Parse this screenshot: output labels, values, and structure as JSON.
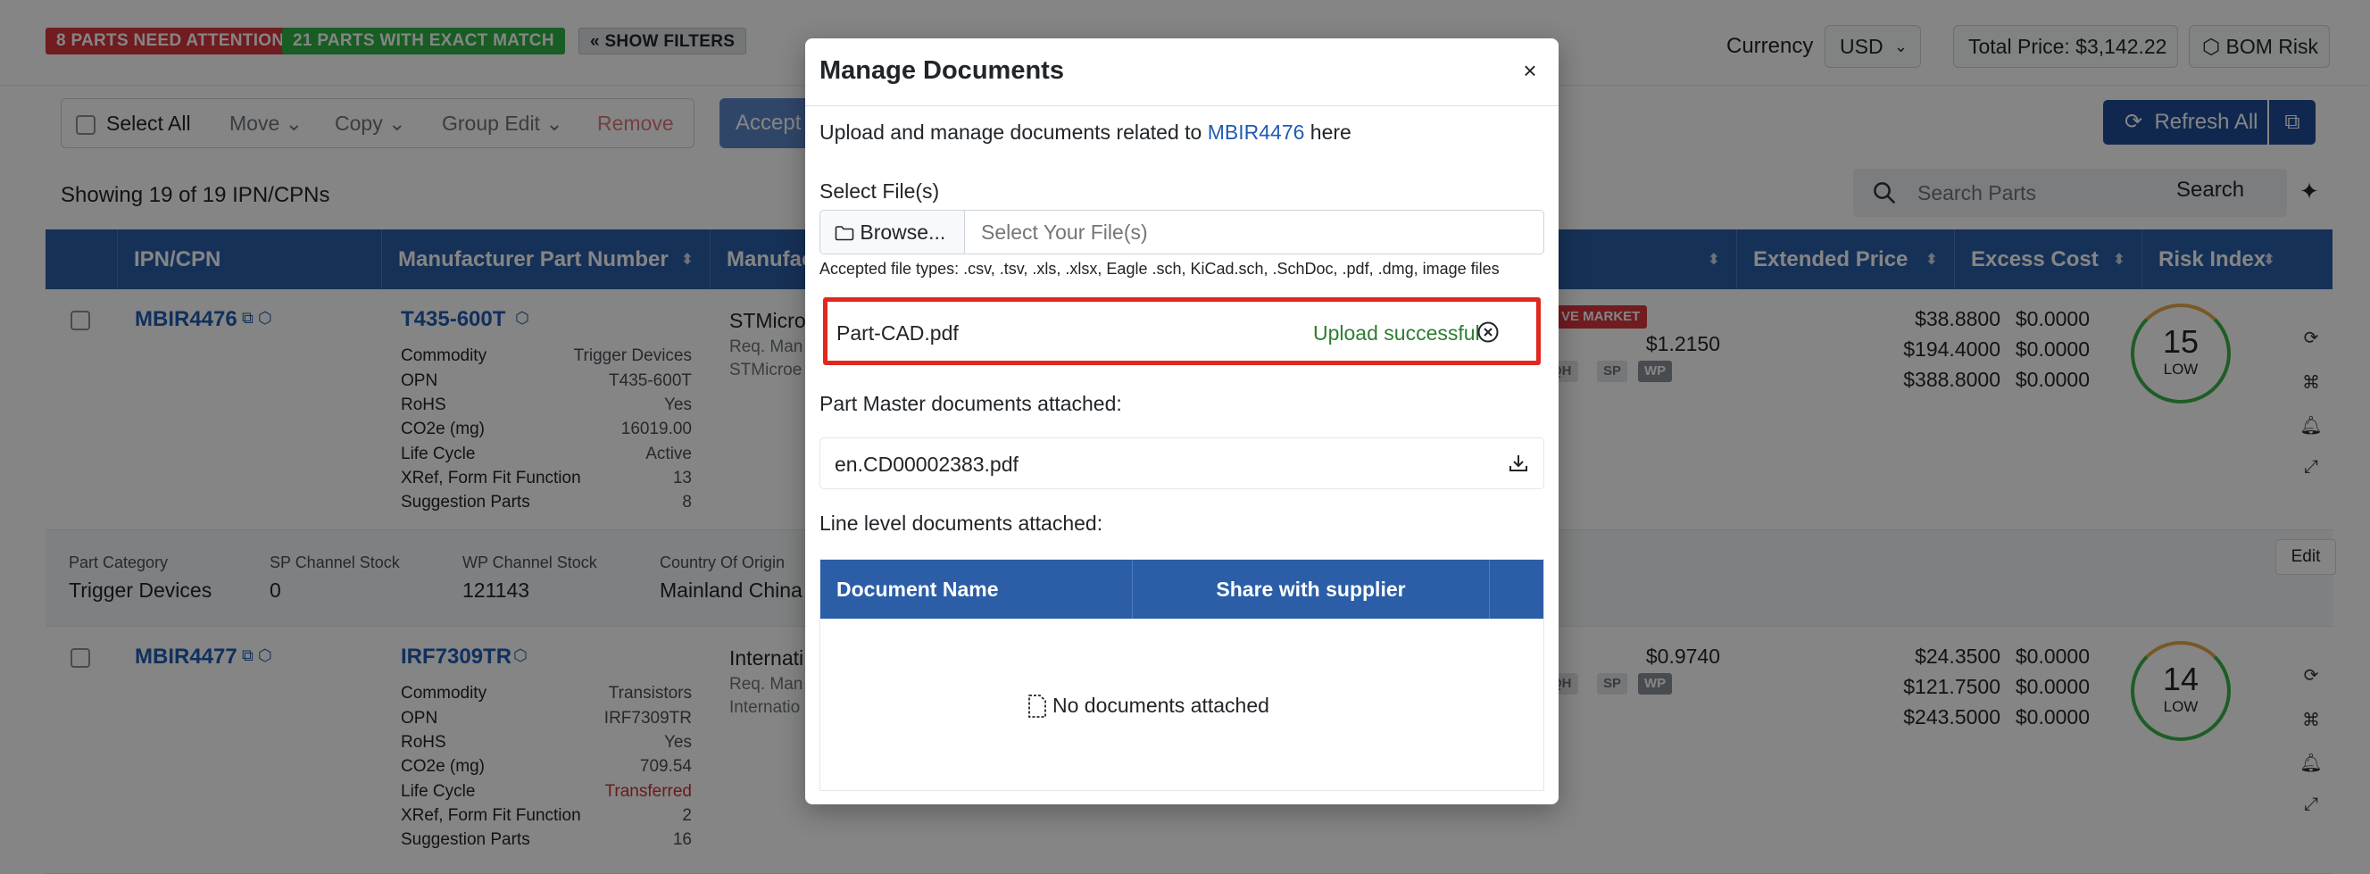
{
  "top": {
    "badge_attention": "8 PARTS NEED ATTENTION",
    "badge_match": "21 PARTS WITH EXACT MATCH",
    "show_filters": "« SHOW FILTERS",
    "currency_label": "Currency",
    "currency_value": "USD",
    "total_price": "Total Price: $3,142.22",
    "bom_risk": "BOM Risk"
  },
  "toolbar": {
    "select_all": "Select All",
    "move": "Move",
    "copy": "Copy",
    "group_edit": "Group Edit",
    "remove": "Remove",
    "accept": "Accept",
    "refresh_all": "Refresh All"
  },
  "list": {
    "showing": "Showing 19 of 19 IPN/CPNs",
    "search_placeholder": "Search Parts",
    "search_button": "Search"
  },
  "table": {
    "headers": [
      "IPN/CPN",
      "Manufacturer Part Number",
      "Manufac",
      "Extended Price",
      "Excess Cost",
      "Risk Index"
    ]
  },
  "rows": [
    {
      "ipn": "MBIR4476",
      "mpn": "T435-600T",
      "commodity_label": "Commodity",
      "commodity": "Trigger Devices",
      "opn_label": "OPN",
      "opn": "T435-600T",
      "rohs_label": "RoHS",
      "rohs": "Yes",
      "co2_label": "CO2e (mg)",
      "co2": "16019.00",
      "lifecycle_label": "Life Cycle",
      "lifecycle": "Active",
      "xref_label": "XRef, Form Fit Function",
      "xref": "13",
      "sugg_label": "Suggestion Parts",
      "sugg": "8",
      "mfr": "STMicro",
      "mfr_sub1": "Req. Man",
      "mfr_sub2": "STMicroe",
      "market": "VE MARKET",
      "unit_price": "$1.2150",
      "ext_prices": [
        "$38.8800",
        "$194.4000",
        "$388.8000"
      ],
      "excess": [
        "$0.0000",
        "$0.0000",
        "$0.0000"
      ],
      "risk": "15",
      "risk_label": "LOW"
    },
    {
      "ipn": "MBIR4477",
      "mpn": "IRF7309TR",
      "commodity_label": "Commodity",
      "commodity": "Transistors",
      "opn_label": "OPN",
      "opn": "IRF7309TR",
      "rohs_label": "RoHS",
      "rohs": "Yes",
      "co2_label": "CO2e (mg)",
      "co2": "709.54",
      "lifecycle_label": "Life Cycle",
      "lifecycle": "Transferred",
      "xref_label": "XRef, Form Fit Function",
      "xref": "2",
      "sugg_label": "Suggestion Parts",
      "sugg": "16",
      "mfr": "Internati",
      "mfr_sub1": "Req. Man",
      "mfr_sub2": "Internatio",
      "unit_price": "$0.9740",
      "ext_prices": [
        "$24.3500",
        "$121.7500",
        "$243.5000"
      ],
      "excess": [
        "$0.0000",
        "$0.0000",
        "$0.0000"
      ],
      "risk": "14",
      "risk_label": "LOW"
    }
  ],
  "pills": [
    "QH",
    "SP",
    "WP"
  ],
  "subrow": {
    "part_category_label": "Part Category",
    "part_category": "Trigger Devices",
    "sp_stock_label": "SP Channel Stock",
    "sp_stock": "0",
    "wp_stock_label": "WP Channel Stock",
    "wp_stock": "121143",
    "origin_label": "Country Of Origin",
    "origin": "Mainland China",
    "edit": "Edit"
  },
  "modal": {
    "title": "Manage Documents",
    "close": "×",
    "intro_prefix": "Upload and manage documents related to",
    "intro_link": "MBIR4476",
    "intro_suffix": "here",
    "select_files_label": "Select File(s)",
    "browse": "Browse...",
    "file_placeholder": "Select Your File(s)",
    "accepted_types": "Accepted file types: .csv, .tsv, .xls, .xlsx, Eagle .sch, KiCad.sch, .SchDoc, .pdf, .dmg, image files",
    "uploaded_file": "Part-CAD.pdf",
    "upload_status": "Upload successful",
    "part_master_label": "Part Master documents attached:",
    "part_master_file": "en.CD00002383.pdf",
    "line_level_label": "Line level documents attached:",
    "col_document_name": "Document Name",
    "col_share": "Share with supplier",
    "empty_text": "No documents attached"
  },
  "colors": {
    "primary": "#2b5ea7",
    "link": "#1f5cb4",
    "danger": "#d9363e",
    "success": "#2fb344",
    "highlight_border": "#e0281f"
  }
}
